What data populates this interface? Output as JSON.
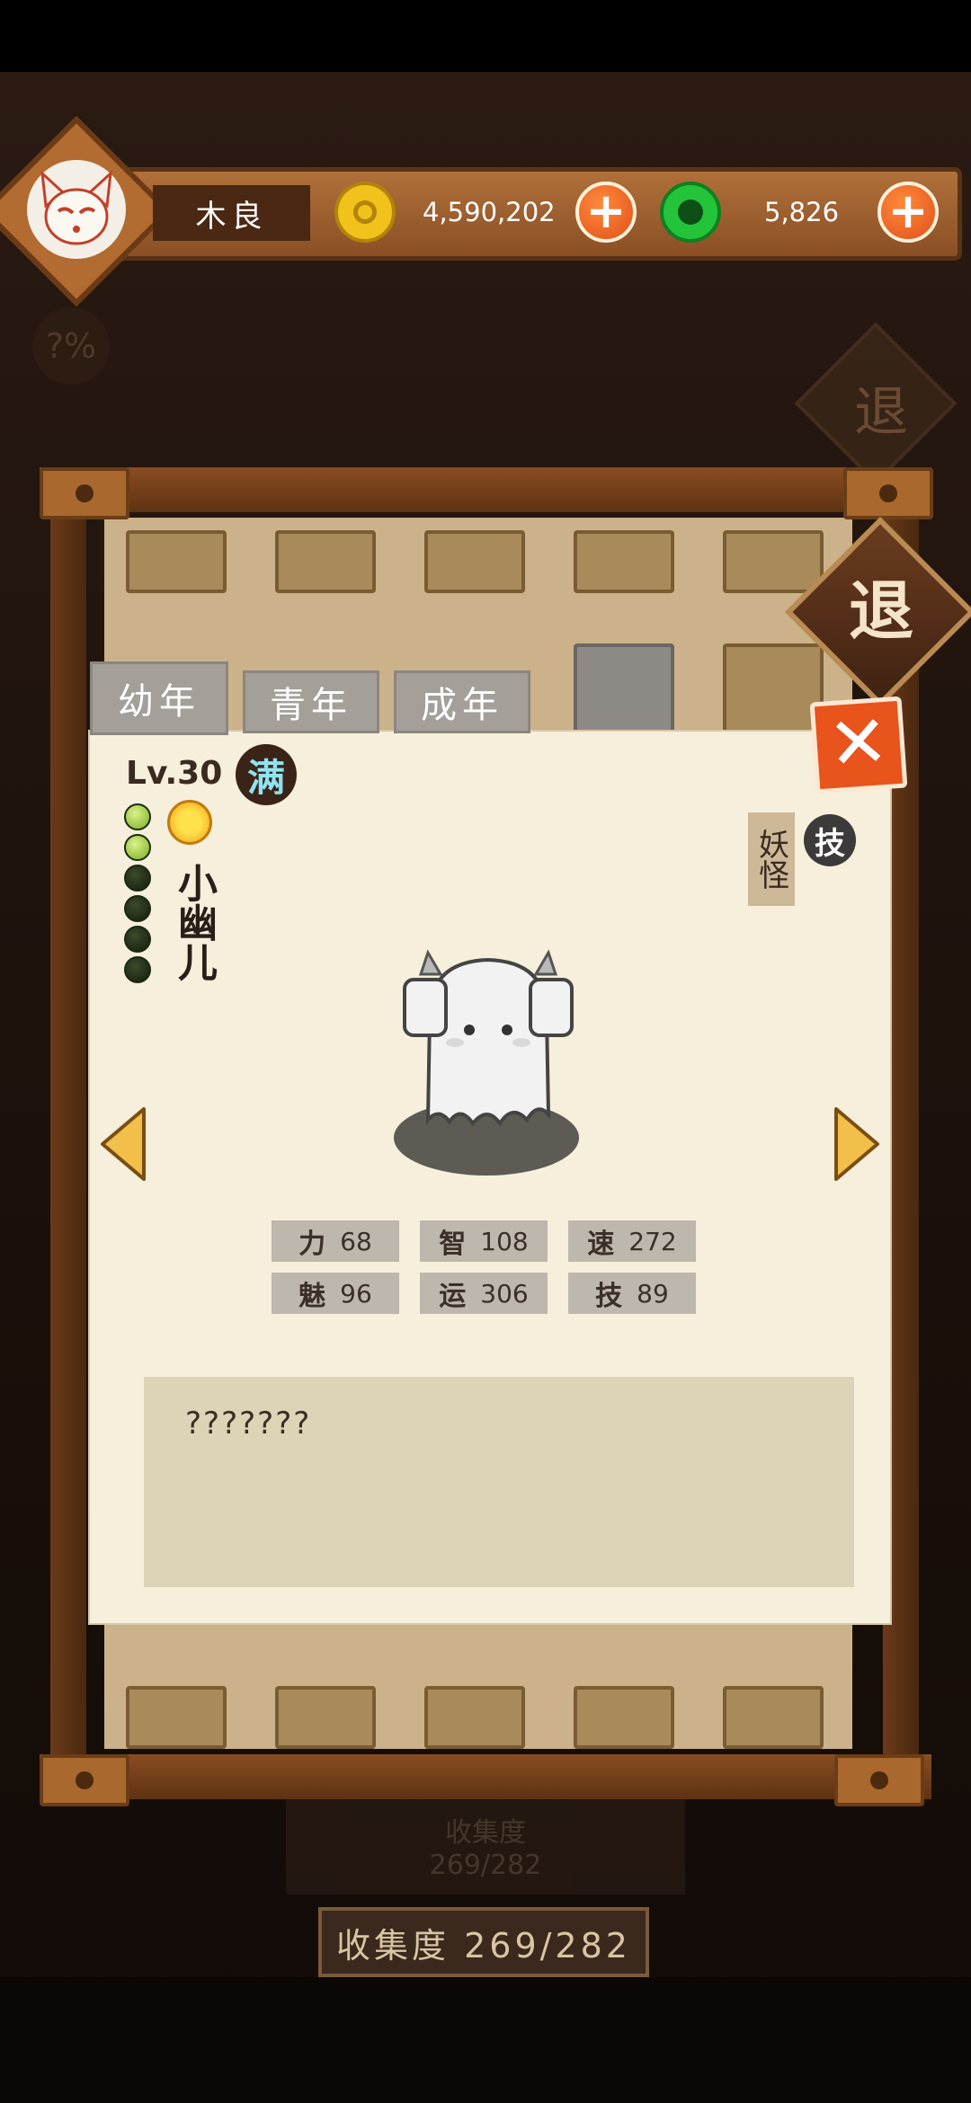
{
  "player": {
    "name": "木良",
    "gold": "4,590,202",
    "jade": "5,826"
  },
  "background": {
    "exit_label": "退",
    "percent_label": "?%",
    "collection_label": "收集度",
    "collection_value": "269/282"
  },
  "tabs": [
    {
      "label": "幼年",
      "active": true
    },
    {
      "label": "青年",
      "active": false
    },
    {
      "label": "成年",
      "active": false
    }
  ],
  "pet": {
    "level": "Lv.30",
    "full_badge": "满",
    "name": "小幽儿",
    "type_tag": "妖怪",
    "skill_badge": "技",
    "stars_on": 2,
    "stars_total": 6,
    "description": "???????"
  },
  "stats": [
    {
      "label": "力",
      "value": "68"
    },
    {
      "label": "智",
      "value": "108"
    },
    {
      "label": "速",
      "value": "272"
    },
    {
      "label": "魅",
      "value": "96"
    },
    {
      "label": "运",
      "value": "306"
    },
    {
      "label": "技",
      "value": "89"
    }
  ],
  "exit_button_label": "退",
  "close_icon": "✕",
  "collection": {
    "label": "收集度 269/282"
  },
  "colors": {
    "accent_orange": "#e8541c",
    "gold": "#f1c21b",
    "jade": "#23c43a",
    "parchment": "#f6efdc"
  }
}
